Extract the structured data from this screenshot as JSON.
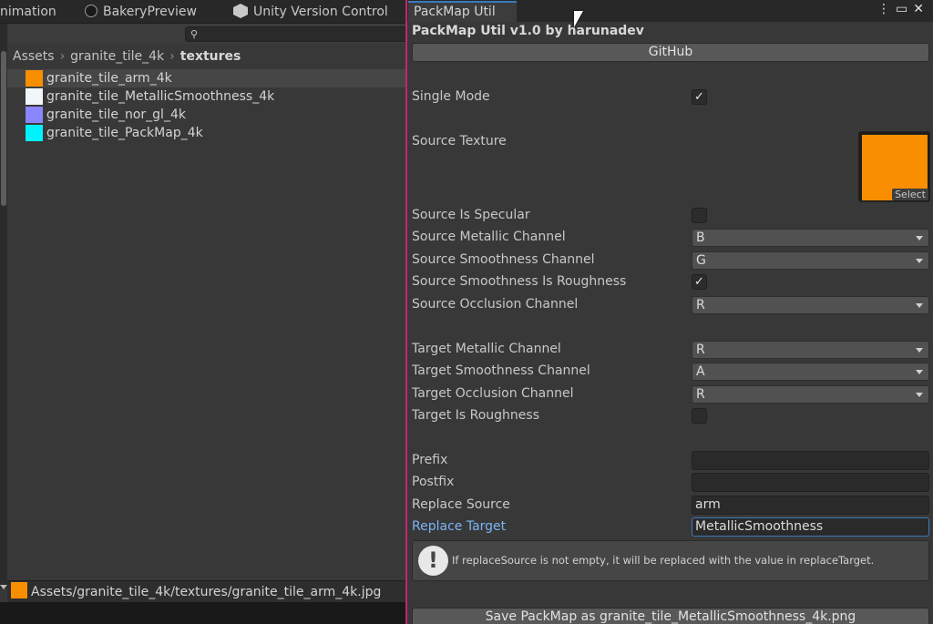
{
  "tabs_left": [
    {
      "label": "nimation"
    },
    {
      "label": "BakeryPreview"
    },
    {
      "label": "Unity Version Control"
    }
  ],
  "project": {
    "search_placeholder": "",
    "breadcrumb": [
      "Assets",
      "granite_tile_4k",
      "textures"
    ],
    "files": [
      {
        "name": "granite_tile_arm_4k",
        "color": "#f98f00",
        "selected": true
      },
      {
        "name": "granite_tile_MetallicSmoothness_4k",
        "color": "#f2f6f8",
        "selected": false
      },
      {
        "name": "granite_tile_nor_gl_4k",
        "color": "#8a86ff",
        "selected": false
      },
      {
        "name": "granite_tile_PackMap_4k",
        "color": "#00f2ff",
        "selected": false
      }
    ],
    "status_path": "Assets/granite_tile_4k/textures/granite_tile_arm_4k.jpg"
  },
  "packmap": {
    "tab_label": "PackMap Util",
    "title": "PackMap Util v1.0 by harunadev",
    "github_button": "GitHub",
    "single_mode_label": "Single Mode",
    "single_mode": true,
    "source_texture_label": "Source Texture",
    "source_texture_color": "#f98f00",
    "select_label": "Select",
    "source_is_specular_label": "Source Is Specular",
    "source_is_specular": false,
    "source_metallic_channel_label": "Source Metallic Channel",
    "source_metallic_channel": "B",
    "source_smoothness_channel_label": "Source Smoothness Channel",
    "source_smoothness_channel": "G",
    "source_smoothness_is_roughness_label": "Source Smoothness Is Roughness",
    "source_smoothness_is_roughness": true,
    "source_occlusion_channel_label": "Source Occlusion Channel",
    "source_occlusion_channel": "R",
    "target_metallic_channel_label": "Target Metallic Channel",
    "target_metallic_channel": "R",
    "target_smoothness_channel_label": "Target Smoothness Channel",
    "target_smoothness_channel": "A",
    "target_occlusion_channel_label": "Target Occlusion Channel",
    "target_occlusion_channel": "R",
    "target_is_roughness_label": "Target Is Roughness",
    "target_is_roughness": false,
    "prefix_label": "Prefix",
    "prefix_value": "",
    "postfix_label": "Postfix",
    "postfix_value": "",
    "replace_source_label": "Replace Source",
    "replace_source_value": "arm",
    "replace_target_label": "Replace Target",
    "replace_target_value": "MetallicSmoothness",
    "help_message": "If replaceSource is not empty, it will be replaced with the value in replaceTarget.",
    "save_button": "Save PackMap as granite_tile_MetallicSmoothness_4k.png"
  },
  "check_glyph": "✓",
  "warning_glyph": "!"
}
